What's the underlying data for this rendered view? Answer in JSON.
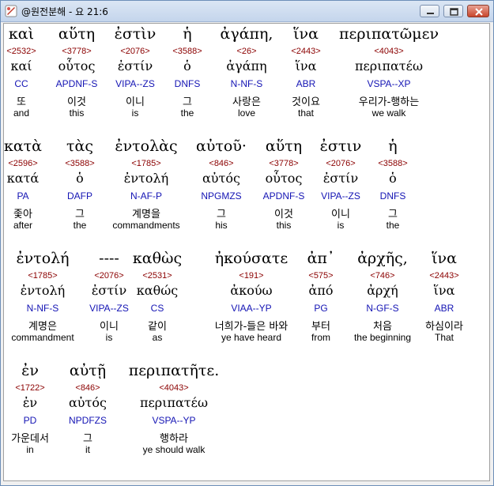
{
  "window": {
    "title": "@원전분해 - 요 21:6",
    "buttons": [
      "minimize",
      "maximize",
      "close"
    ]
  },
  "lines": [
    {
      "words": [
        {
          "greek": "καὶ",
          "strong": "<2532>",
          "lemma": "καί",
          "parse": "CC",
          "korean": "또",
          "english": "and",
          "highlighted": true
        },
        {
          "greek": "αὕτη",
          "strong": "<3778>",
          "lemma": "οὗτος",
          "parse": "APDNF-S",
          "korean": "이것",
          "english": "this"
        },
        {
          "greek": "ἐστὶν",
          "strong": "<2076>",
          "lemma": "ἐστίν",
          "parse": "VIPA--ZS",
          "korean": "이니",
          "english": "is"
        },
        {
          "greek": "ἡ",
          "strong": "<3588>",
          "lemma": "ὁ",
          "parse": "DNFS",
          "korean": "그",
          "english": "the"
        },
        {
          "greek": "ἀγάπη,",
          "strong": "<26>",
          "lemma": "ἀγάπη",
          "parse": "N-NF-S",
          "korean": "사랑은",
          "english": "love"
        },
        {
          "greek": "ἵνα",
          "strong": "<2443>",
          "lemma": "ἵνα",
          "parse": "ABR",
          "korean": "것이요",
          "english": "that"
        },
        {
          "greek": "περιπατῶμεν",
          "strong": "<4043>",
          "lemma": "περιπατέω",
          "parse": "VSPA--XP",
          "korean": "우리가-행하는",
          "english": "we walk"
        }
      ]
    },
    {
      "words": [
        {
          "greek": "κατὰ",
          "strong": "<2596>",
          "lemma": "κατά",
          "parse": "PA",
          "korean": "좇아",
          "english": "after"
        },
        {
          "greek": "τὰς",
          "strong": "<3588>",
          "lemma": "ὁ",
          "parse": "DAFP",
          "korean": "그",
          "english": "the"
        },
        {
          "greek": "ἐντολὰς",
          "strong": "<1785>",
          "lemma": "ἐντολή",
          "parse": "N-AF-P",
          "korean": "계명을",
          "english": "commandments"
        },
        {
          "greek": "αὐτοῦ·",
          "strong": "<846>",
          "lemma": "αὐτός",
          "parse": "NPGMZS",
          "korean": "그",
          "english": "his"
        },
        {
          "greek": "αὕτη",
          "strong": "<3778>",
          "lemma": "οὗτος",
          "parse": "APDNF-S",
          "korean": "이것",
          "english": "this"
        },
        {
          "greek": "ἐστιν",
          "strong": "<2076>",
          "lemma": "ἐστίν",
          "parse": "VIPA--ZS",
          "korean": "이니",
          "english": "is"
        },
        {
          "greek": "ἡ",
          "strong": "<3588>",
          "lemma": "ὁ",
          "parse": "DNFS",
          "korean": "그",
          "english": "the"
        }
      ]
    },
    {
      "words": [
        {
          "greek": "ἐντολή",
          "strong": "<1785>",
          "lemma": "ἐντολή",
          "parse": "N-NF-S",
          "korean": "계명은",
          "english": "commandment"
        },
        {
          "greek": "----",
          "strong": "<2076>",
          "lemma": "ἐστίν",
          "parse": "VIPA--ZS",
          "korean": "이니",
          "english": "is"
        },
        {
          "greek": "καθὼς",
          "strong": "<2531>",
          "lemma": "καθώς",
          "parse": "CS",
          "korean": "같이",
          "english": "as"
        },
        {
          "greek": "ἠκούσατε",
          "strong": "<191>",
          "lemma": "ἀκούω",
          "parse": "VIAA--YP",
          "korean": "너희가-들은 바와",
          "english": "ye have heard"
        },
        {
          "greek": "ἀπ᾽",
          "strong": "<575>",
          "lemma": "ἀπό",
          "parse": "PG",
          "korean": "부터",
          "english": "from"
        },
        {
          "greek": "ἀρχῆς,",
          "strong": "<746>",
          "lemma": "ἀρχή",
          "parse": "N-GF-S",
          "korean": "처음",
          "english": "the beginning"
        },
        {
          "greek": "ἵνα",
          "strong": "<2443>",
          "lemma": "ἵνα",
          "parse": "ABR",
          "korean": "하심이라",
          "english": "That"
        }
      ]
    },
    {
      "words": [
        {
          "greek": "ἐν",
          "strong": "<1722>",
          "lemma": "ἐν",
          "parse": "PD",
          "korean": "가운데서",
          "english": "in"
        },
        {
          "greek": "αὐτῇ",
          "strong": "<846>",
          "lemma": "αὐτός",
          "parse": "NPDFZS",
          "korean": "그",
          "english": "it"
        },
        {
          "greek": "περιπατῆτε.",
          "strong": "<4043>",
          "lemma": "περιπατέω",
          "parse": "VSPA--YP",
          "korean": "행하라",
          "english": "ye should walk"
        }
      ]
    }
  ]
}
